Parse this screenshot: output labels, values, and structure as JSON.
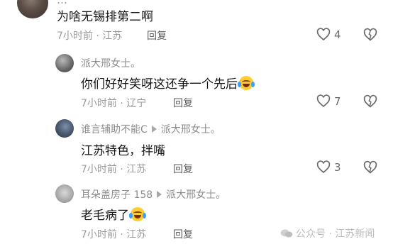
{
  "top_cut_text": "…",
  "comments": [
    {
      "text": "为啥无锡排第二啊",
      "meta": "7小时前 · 江苏",
      "reply_label": "回复",
      "likes": "4"
    },
    {
      "author": "派大邢女士。",
      "text": "你们好好笑呀这还争一个先后",
      "meta": "7小时前 · 辽宁",
      "reply_label": "回复",
      "likes": "7"
    },
    {
      "author": "谁言辅助不能C",
      "reply_to": "派大邢女士。",
      "text": "江苏特色，拌嘴",
      "meta": "7小时前 · 江苏",
      "reply_label": "回复",
      "likes": "3"
    },
    {
      "author": "耳朵盖房子 158",
      "reply_to": "派大邢女士。",
      "text": "老毛病了",
      "meta": "7小时前 · 江苏",
      "reply_label": "回复",
      "likes": ""
    }
  ],
  "watermark": "公众号 · 江苏新闻",
  "icons": {
    "like": "heart-outline-icon",
    "dislike": "broken-heart-icon",
    "arrow": "triangle-right-icon",
    "emoji": "crying-laughing-emoji-icon",
    "watermark": "wechat-icon"
  }
}
